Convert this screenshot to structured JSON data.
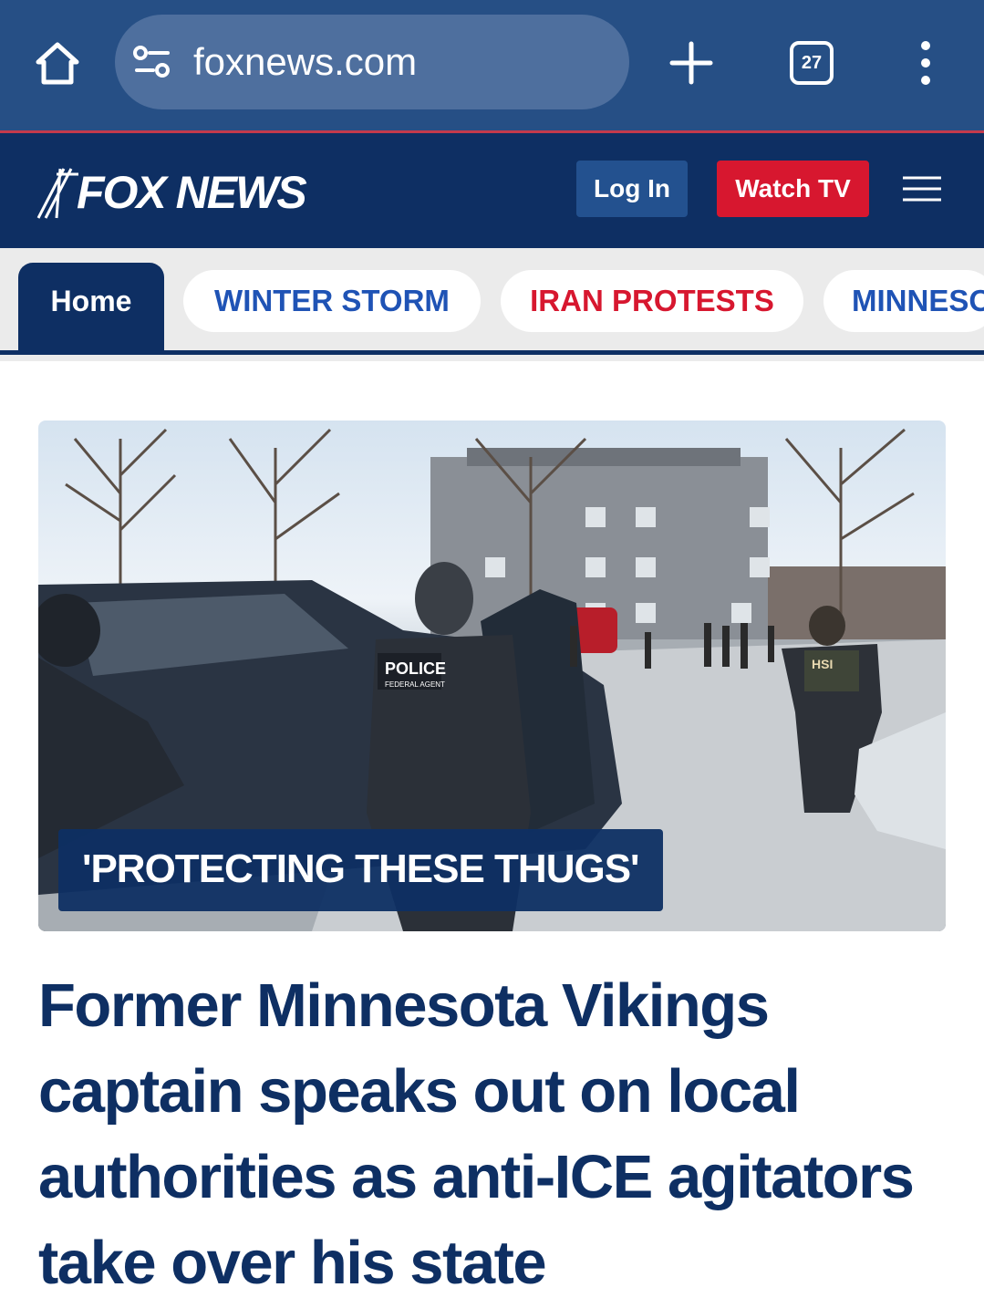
{
  "browser": {
    "url": "foxnews.com",
    "tab_count": "27"
  },
  "header": {
    "logo_text": "FOX NEWS",
    "login_label": "Log In",
    "watch_label": "Watch TV"
  },
  "nav": {
    "tabs": [
      {
        "label": "Home"
      },
      {
        "label": "WINTER STORM"
      },
      {
        "label": "IRAN PROTESTS"
      },
      {
        "label": "MINNESO"
      }
    ]
  },
  "story": {
    "kicker": "'PROTECTING THESE THUGS'",
    "headline": "Former Minnesota Vikings captain speaks out on local authorities as anti-ICE agitators take over his state",
    "image_labels": {
      "police_patch": "POLICE",
      "agent_patch": "FEDERAL AGENT",
      "hsi_patch": "HSI"
    }
  },
  "colors": {
    "browser_bar": "#264f85",
    "fox_navy": "#0e2f63",
    "watch_red": "#d7172f",
    "link_blue": "#1f53b5"
  },
  "icons": [
    "home-icon",
    "site-settings-icon",
    "new-tab-plus-icon",
    "tab-switcher-icon",
    "overflow-menu-icon",
    "hamburger-menu-icon"
  ]
}
